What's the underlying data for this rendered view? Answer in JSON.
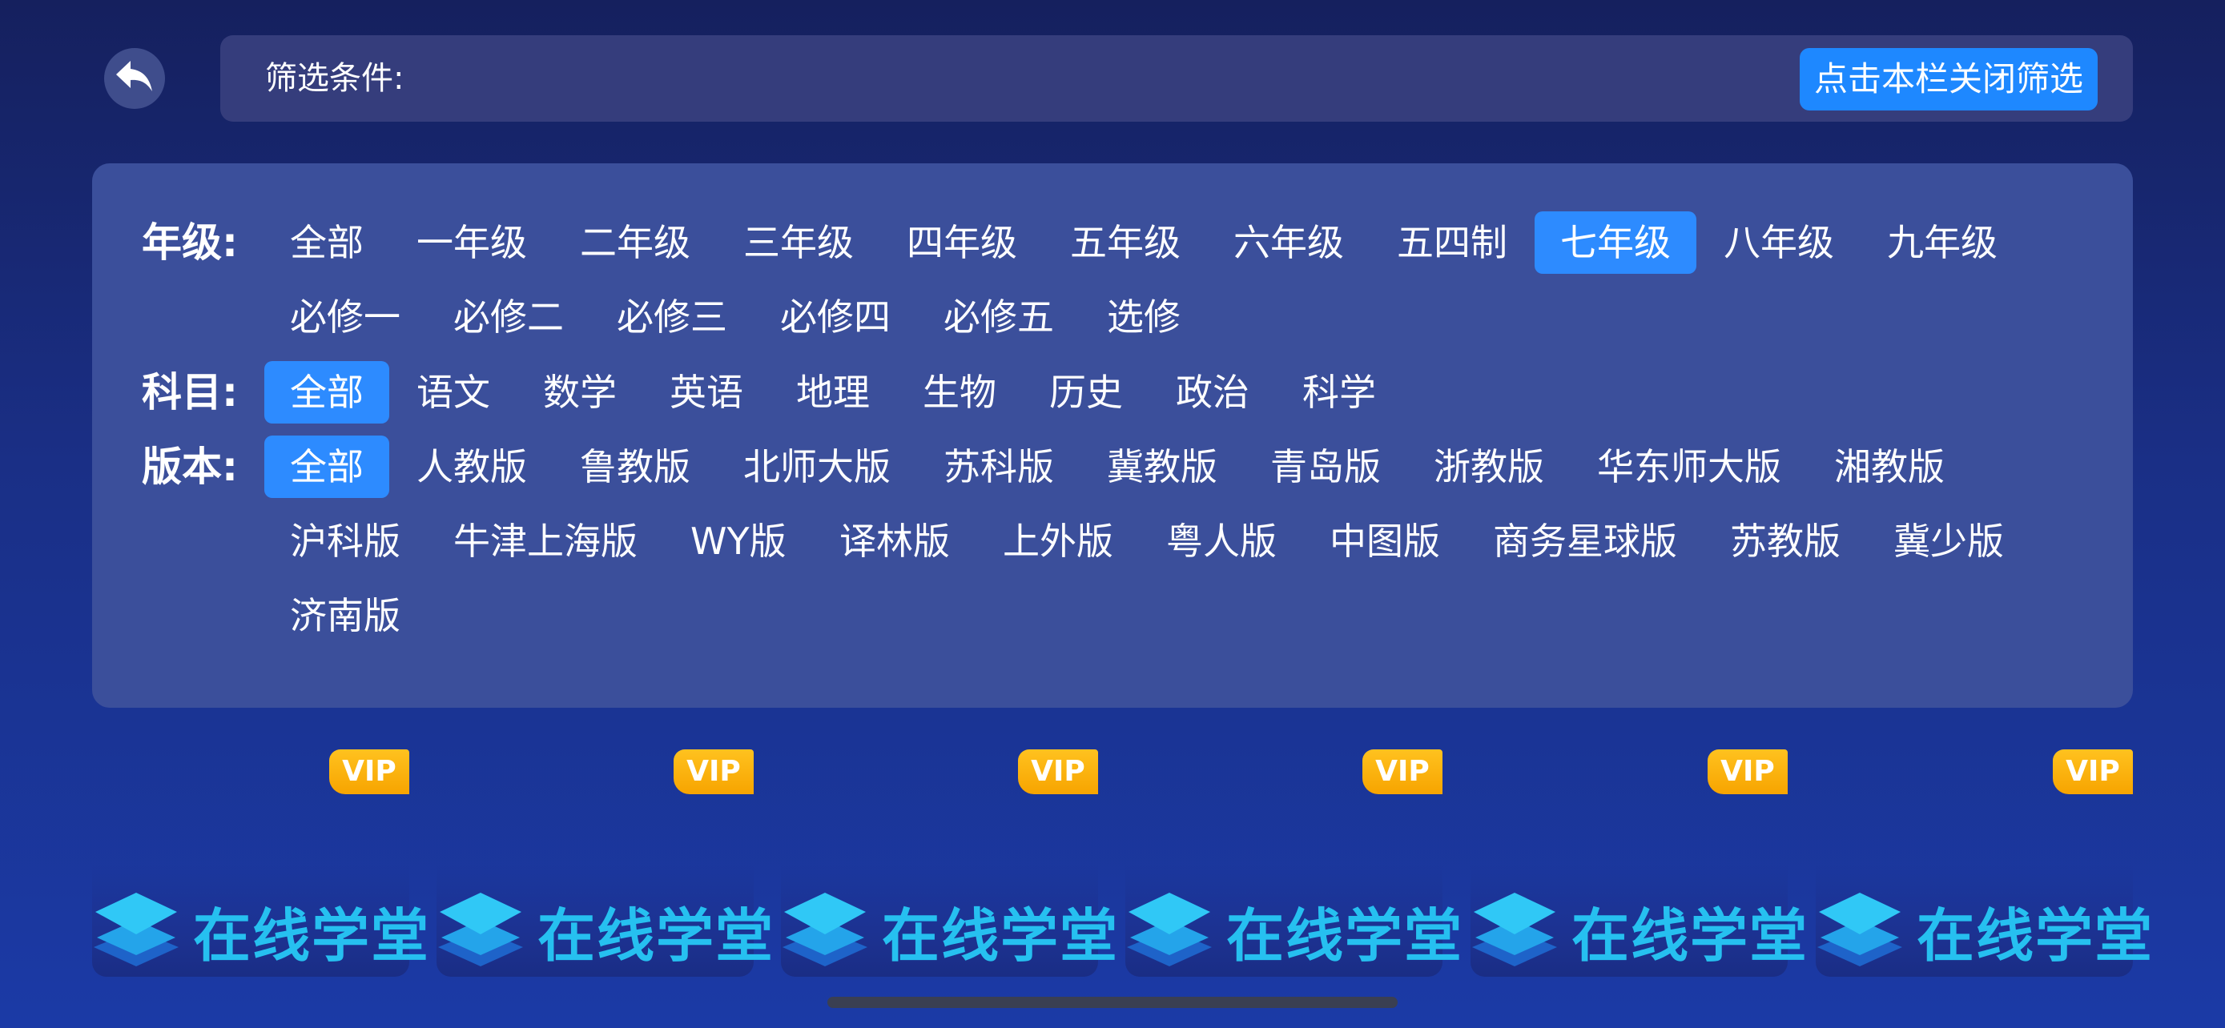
{
  "header": {
    "filter_title": "筛选条件:",
    "close_button": "点击本栏关闭筛选"
  },
  "grade": {
    "label": "年级:",
    "options": [
      "全部",
      "一年级",
      "二年级",
      "三年级",
      "四年级",
      "五年级",
      "六年级",
      "五四制",
      "七年级",
      "八年级",
      "九年级",
      "必修一",
      "必修二",
      "必修三",
      "必修四",
      "必修五",
      "选修"
    ],
    "selected": "七年级"
  },
  "subject": {
    "label": "科目:",
    "options": [
      "全部",
      "语文",
      "数学",
      "英语",
      "地理",
      "生物",
      "历史",
      "政治",
      "科学"
    ],
    "selected": "全部"
  },
  "edition": {
    "label": "版本:",
    "options": [
      "全部",
      "人教版",
      "鲁教版",
      "北师大版",
      "苏科版",
      "冀教版",
      "青岛版",
      "浙教版",
      "华东师大版",
      "湘教版",
      "沪科版",
      "牛津上海版",
      "WY版",
      "译林版",
      "上外版",
      "粤人版",
      "中图版",
      "商务星球版",
      "苏教版",
      "冀少版",
      "济南版"
    ],
    "selected": "全部"
  },
  "cards": [
    {
      "badge": "VIP",
      "logo_text": "在线学堂"
    },
    {
      "badge": "VIP",
      "logo_text": "在线学堂"
    },
    {
      "badge": "VIP",
      "logo_text": "在线学堂"
    },
    {
      "badge": "VIP",
      "logo_text": "在线学堂"
    },
    {
      "badge": "VIP",
      "logo_text": "在线学堂"
    },
    {
      "badge": "VIP",
      "logo_text": "在线学堂"
    }
  ],
  "icons": {
    "back": "back-arrow-icon",
    "logo": "layers-logo-icon"
  },
  "colors": {
    "accent": "#1e88ff",
    "selected": "#2d8bff",
    "vip": "#ffb400",
    "logo": "#26c0f0"
  }
}
